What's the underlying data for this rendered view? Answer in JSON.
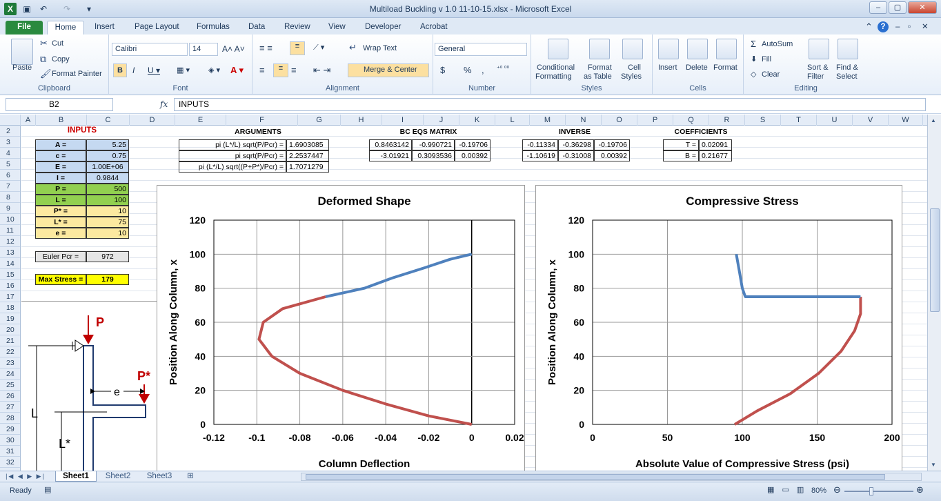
{
  "window": {
    "title": "Multiload Buckling v 1.0 11-10-15.xlsx  -  Microsoft Excel",
    "min": "–",
    "max": "▢",
    "close": "✕"
  },
  "tabs": [
    "File",
    "Home",
    "Insert",
    "Page Layout",
    "Formulas",
    "Data",
    "Review",
    "View",
    "Developer",
    "Acrobat"
  ],
  "ribbon": {
    "clipboard": {
      "paste": "Paste",
      "cut": "Cut",
      "copy": "Copy",
      "format_painter": "Format Painter",
      "label": "Clipboard"
    },
    "font": {
      "name": "Calibri",
      "size": "14",
      "label": "Font"
    },
    "alignment": {
      "wrap": "Wrap Text",
      "merge": "Merge & Center",
      "label": "Alignment"
    },
    "number": {
      "format": "General",
      "label": "Number",
      "currency": "$",
      "percent": "%",
      "comma": ","
    },
    "styles": {
      "cond": "Conditional",
      "cond2": "Formatting",
      "table": "Format",
      "table2": "as Table",
      "cell": "Cell",
      "cell2": "Styles",
      "label": "Styles"
    },
    "cells": {
      "insert": "Insert",
      "delete": "Delete",
      "format": "Format",
      "label": "Cells"
    },
    "editing": {
      "autosum": "AutoSum",
      "fill": "Fill",
      "clear": "Clear",
      "sort": "Sort &",
      "sort2": "Filter",
      "find": "Find &",
      "find2": "Select",
      "label": "Editing"
    }
  },
  "formula_bar": {
    "name_box": "B2",
    "fx": "fx",
    "value": "INPUTS"
  },
  "columns": [
    "A",
    "B",
    "C",
    "D",
    "E",
    "F",
    "G",
    "H",
    "I",
    "J",
    "K",
    "L",
    "M",
    "N",
    "O",
    "P",
    "Q",
    "R",
    "S",
    "T",
    "U",
    "V",
    "W"
  ],
  "rows": [
    "2",
    "3",
    "4",
    "5",
    "6",
    "7",
    "8",
    "9",
    "10",
    "11",
    "12",
    "13",
    "14",
    "15",
    "16",
    "17",
    "18",
    "19",
    "20",
    "21",
    "22",
    "23",
    "24",
    "25",
    "26",
    "27",
    "28",
    "29",
    "30",
    "31",
    "32"
  ],
  "inputs": {
    "header": "INPUTS",
    "items": [
      {
        "label": "A =",
        "value": "5.25",
        "color": "blue"
      },
      {
        "label": "c =",
        "value": "0.75",
        "color": "blue"
      },
      {
        "label": "E =",
        "value": "1.00E+06",
        "color": "blue"
      },
      {
        "label": "I =",
        "value": "0.9844",
        "color": "blue"
      },
      {
        "label": "P =",
        "value": "500",
        "color": "green"
      },
      {
        "label": "L =",
        "value": "100",
        "color": "green"
      },
      {
        "label": "P* =",
        "value": "10",
        "color": "tan"
      },
      {
        "label": "L* =",
        "value": "75",
        "color": "tan"
      },
      {
        "label": "e =",
        "value": "10",
        "color": "tan"
      }
    ],
    "euler_label": "Euler Pcr =",
    "euler_value": "972",
    "maxstress_label": "Max Stress =",
    "maxstress_value": "179"
  },
  "arguments": {
    "header": "ARGUMENTS",
    "rows": [
      {
        "label": "pi (L*/L) sqrt(P/Pcr) =",
        "value": "1.6903085"
      },
      {
        "label": "pi sqrt(P/Pcr) =",
        "value": "2.2537447"
      },
      {
        "label": "pi (L*/L) sqrt((P+P*)/Pcr) =",
        "value": "1.7071279"
      }
    ]
  },
  "bc_matrix": {
    "header": "BC EQS MATRIX",
    "rows": [
      [
        "0.8463142",
        "-0.990721",
        "-0.19706"
      ],
      [
        "-3.01921",
        "0.3093536",
        "0.00392"
      ]
    ]
  },
  "inverse": {
    "header": "INVERSE",
    "rows": [
      [
        "-0.11334",
        "-0.36298",
        "-0.19706"
      ],
      [
        "-1.10619",
        "-0.31008",
        "0.00392"
      ]
    ]
  },
  "coefficients": {
    "header": "COEFFICIENTS",
    "rows": [
      {
        "label": "T =",
        "value": "0.02091"
      },
      {
        "label": "B =",
        "value": "0.21677"
      }
    ]
  },
  "diagram": {
    "P": "P",
    "Pstar": "P*",
    "e": "e",
    "L": "L",
    "Lstar": "L*"
  },
  "chart_data": [
    {
      "type": "line",
      "title": "Deformed Shape",
      "xlabel": "Column Deflection",
      "ylabel": "Position Along Column, x",
      "xlim": [
        -0.12,
        0.02
      ],
      "ylim": [
        0,
        120
      ],
      "xticks": [
        "-0.12",
        "-0.1",
        "-0.08",
        "-0.06",
        "-0.04",
        "-0.02",
        "0",
        "0.02"
      ],
      "yticks": [
        "0",
        "20",
        "40",
        "60",
        "80",
        "100",
        "120"
      ],
      "grid": true,
      "series": [
        {
          "color": "#c0504d",
          "points": [
            [
              0,
              0
            ],
            [
              -0.02,
              5
            ],
            [
              -0.04,
              12
            ],
            [
              -0.06,
              20
            ],
            [
              -0.08,
              30
            ],
            [
              -0.093,
              40
            ],
            [
              -0.099,
              50
            ],
            [
              -0.097,
              60
            ],
            [
              -0.088,
              68
            ],
            [
              -0.068,
              75
            ]
          ]
        },
        {
          "color": "#4f81bd",
          "points": [
            [
              -0.068,
              75
            ],
            [
              -0.05,
              80
            ],
            [
              -0.037,
              86
            ],
            [
              -0.022,
              92
            ],
            [
              -0.01,
              97
            ],
            [
              0,
              100
            ]
          ]
        }
      ]
    },
    {
      "type": "line",
      "title": "Compressive Stress",
      "xlabel": "Absolute Value of Compressive Stress (psi)",
      "ylabel": "Position Along Column, x",
      "xlim": [
        0,
        200
      ],
      "ylim": [
        0,
        120
      ],
      "xticks": [
        "0",
        "50",
        "100",
        "150",
        "200"
      ],
      "yticks": [
        "0",
        "20",
        "40",
        "60",
        "80",
        "100",
        "120"
      ],
      "grid": true,
      "series": [
        {
          "color": "#c0504d",
          "points": [
            [
              95,
              0
            ],
            [
              110,
              8
            ],
            [
              132,
              18
            ],
            [
              151,
              30
            ],
            [
              166,
              43
            ],
            [
              175,
              55
            ],
            [
              179,
              65
            ],
            [
              179,
              75
            ]
          ]
        },
        {
          "color": "#4f81bd",
          "points": [
            [
              179,
              75
            ],
            [
              102,
              75
            ],
            [
              100,
              80
            ],
            [
              98,
              90
            ],
            [
              96,
              100
            ]
          ]
        }
      ]
    }
  ],
  "sheet_tabs": [
    "Sheet1",
    "Sheet2",
    "Sheet3"
  ],
  "status": {
    "ready": "Ready",
    "zoom": "80%"
  }
}
